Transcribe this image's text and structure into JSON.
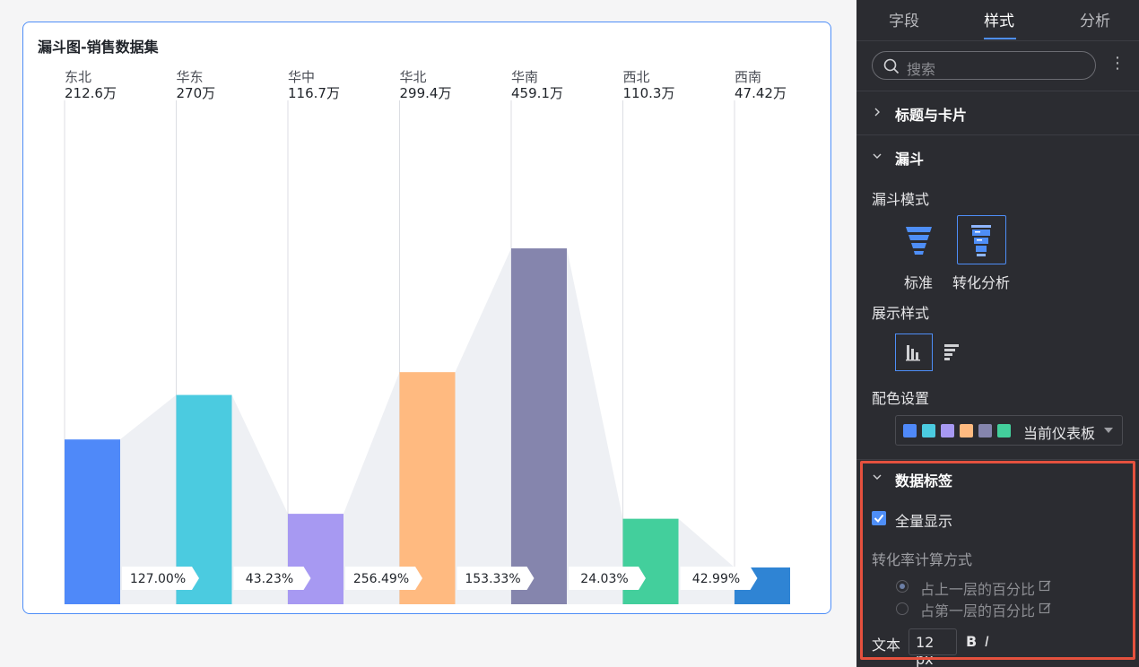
{
  "card": {
    "title": "漏斗图-销售数据集"
  },
  "chart_data": {
    "type": "bar",
    "title": "漏斗图-销售数据集",
    "categories": [
      "东北",
      "华东",
      "华中",
      "华北",
      "华南",
      "西北",
      "西南"
    ],
    "value_labels": [
      "212.6万",
      "270万",
      "116.7万",
      "299.4万",
      "459.1万",
      "110.3万",
      "47.42万"
    ],
    "values": [
      212.6,
      270,
      116.7,
      299.4,
      459.1,
      110.3,
      47.42
    ],
    "unit": "万",
    "colors": [
      "#4f89f9",
      "#4bcbe0",
      "#a799f2",
      "#ffba80",
      "#8585ad",
      "#43cf9c",
      "#2f84d4"
    ],
    "conversion_labels": [
      "127.00%",
      "43.23%",
      "256.49%",
      "153.33%",
      "24.03%",
      "42.99%"
    ],
    "conversion_rates": [
      127.0,
      43.23,
      256.49,
      153.33,
      24.03,
      42.99
    ],
    "ylim": [
      0,
      650
    ],
    "grid": false,
    "legend": "none"
  },
  "panel": {
    "tabs": [
      "字段",
      "样式",
      "分析"
    ],
    "active_tab": "样式",
    "search_placeholder": "搜索",
    "more_icon": "⋮",
    "sections": {
      "title_card": "标题与卡片",
      "funnel": "漏斗",
      "data_labels": "数据标签"
    },
    "funnel_mode_label": "漏斗模式",
    "funnel_modes": [
      "标准",
      "转化分析"
    ],
    "display_style_label": "展示样式",
    "color_setting_label": "配色设置",
    "palette_name": "当前仪表板",
    "palette_colors": [
      "#4f89f9",
      "#4bcbe0",
      "#a799f2",
      "#ffba80",
      "#8585ad",
      "#43cf9c"
    ],
    "show_all_label": "全量显示",
    "conversion_calc_label": "转化率计算方式",
    "calc_options": [
      "占上一层的百分比",
      "占第一层的百分比"
    ],
    "text_label": "文本",
    "font_size": "12 px",
    "bold_label": "B",
    "italic_label": "I"
  }
}
